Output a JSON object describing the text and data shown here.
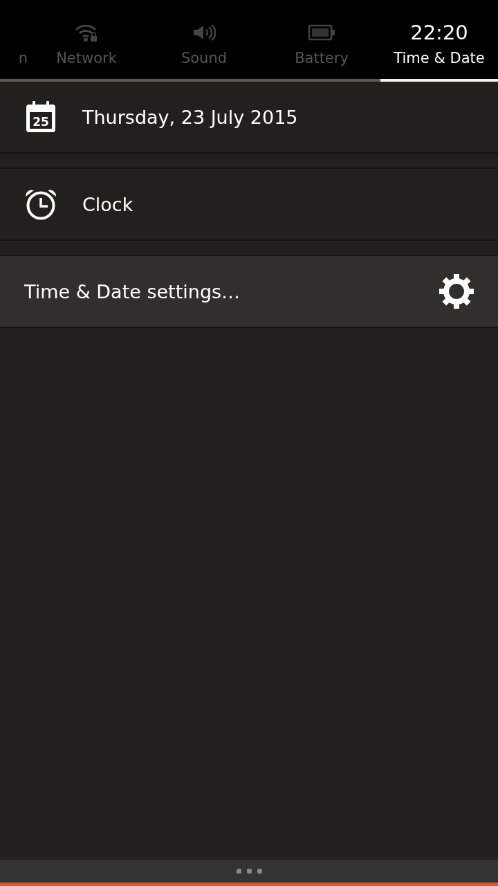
{
  "tabs": [
    {
      "label": "n",
      "kind": "none",
      "selected": false
    },
    {
      "label": "Network",
      "kind": "wifi",
      "selected": false
    },
    {
      "label": "Sound",
      "kind": "sound",
      "selected": false
    },
    {
      "label": "Battery",
      "kind": "battery",
      "selected": false
    },
    {
      "label": "Time & Date",
      "kind": "time",
      "time": "22:20",
      "selected": true
    }
  ],
  "items": [
    {
      "kind": "calendar",
      "label": "Thursday, 23 July 2015",
      "day": "25"
    },
    {
      "kind": "clock",
      "label": "Clock"
    },
    {
      "kind": "settings",
      "label": "Time & Date settings…"
    }
  ]
}
